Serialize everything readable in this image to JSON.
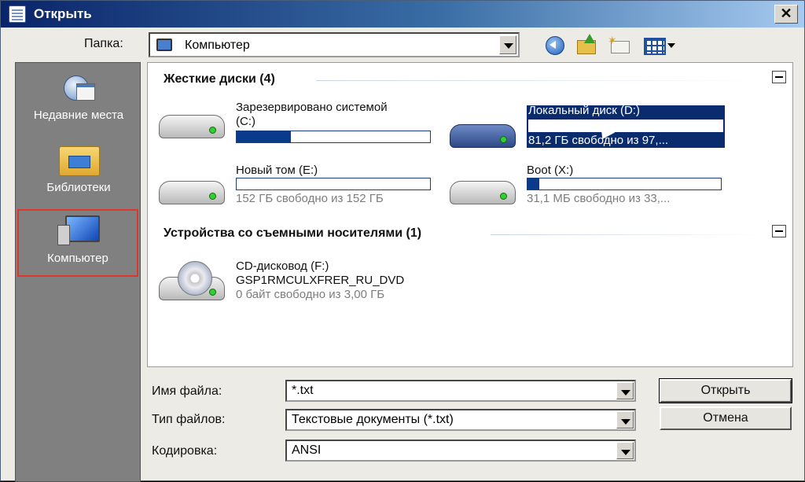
{
  "window": {
    "title": "Открыть"
  },
  "toolbar": {
    "folder_label": "Папка:",
    "folder_value": "Компьютер"
  },
  "places": {
    "recent": "Недавние места",
    "libraries": "Библиотеки",
    "computer": "Компьютер"
  },
  "groups": {
    "hard_drives": "Жесткие диски (4)",
    "removable": "Устройства со съемными носителями (1)"
  },
  "drives": [
    {
      "name": "Зарезервировано системой",
      "name2": "(C:)",
      "free": "",
      "used_fraction": 0.28,
      "icon": "hdd-icon",
      "selected": false
    },
    {
      "name": "Локальный диск (D:)",
      "name2": "",
      "free": "81,2 ГБ свободно из 97,...",
      "used_fraction": 0.18,
      "icon": "hdd-icon",
      "selected": true
    },
    {
      "name": "Новый том (E:)",
      "name2": "",
      "free": "152 ГБ свободно из 152 ГБ",
      "used_fraction": 0.0,
      "icon": "hdd-icon",
      "selected": false
    },
    {
      "name": "Boot (X:)",
      "name2": "",
      "free": "31,1 МБ свободно из 33,...",
      "used_fraction": 0.06,
      "icon": "hdd-icon",
      "selected": false
    }
  ],
  "cd": {
    "name": "CD-дисковод (F:)",
    "label": "GSP1RMCULXFRER_RU_DVD",
    "free": "0 байт свободно из 3,00 ГБ",
    "icon": "cd-drive-icon"
  },
  "form": {
    "filename_label": "Имя файла:",
    "filename_value": "*.txt",
    "filetype_label": "Тип файлов:",
    "filetype_value": "Текстовые документы (*.txt)",
    "encoding_label": "Кодировка:",
    "encoding_value": "ANSI"
  },
  "buttons": {
    "open": "Открыть",
    "cancel": "Отмена",
    "close": "✕"
  },
  "colors": {
    "selection": "#0a2c6e",
    "usage_bar": "#0a3a8a",
    "highlight_border": "#e0352a"
  }
}
